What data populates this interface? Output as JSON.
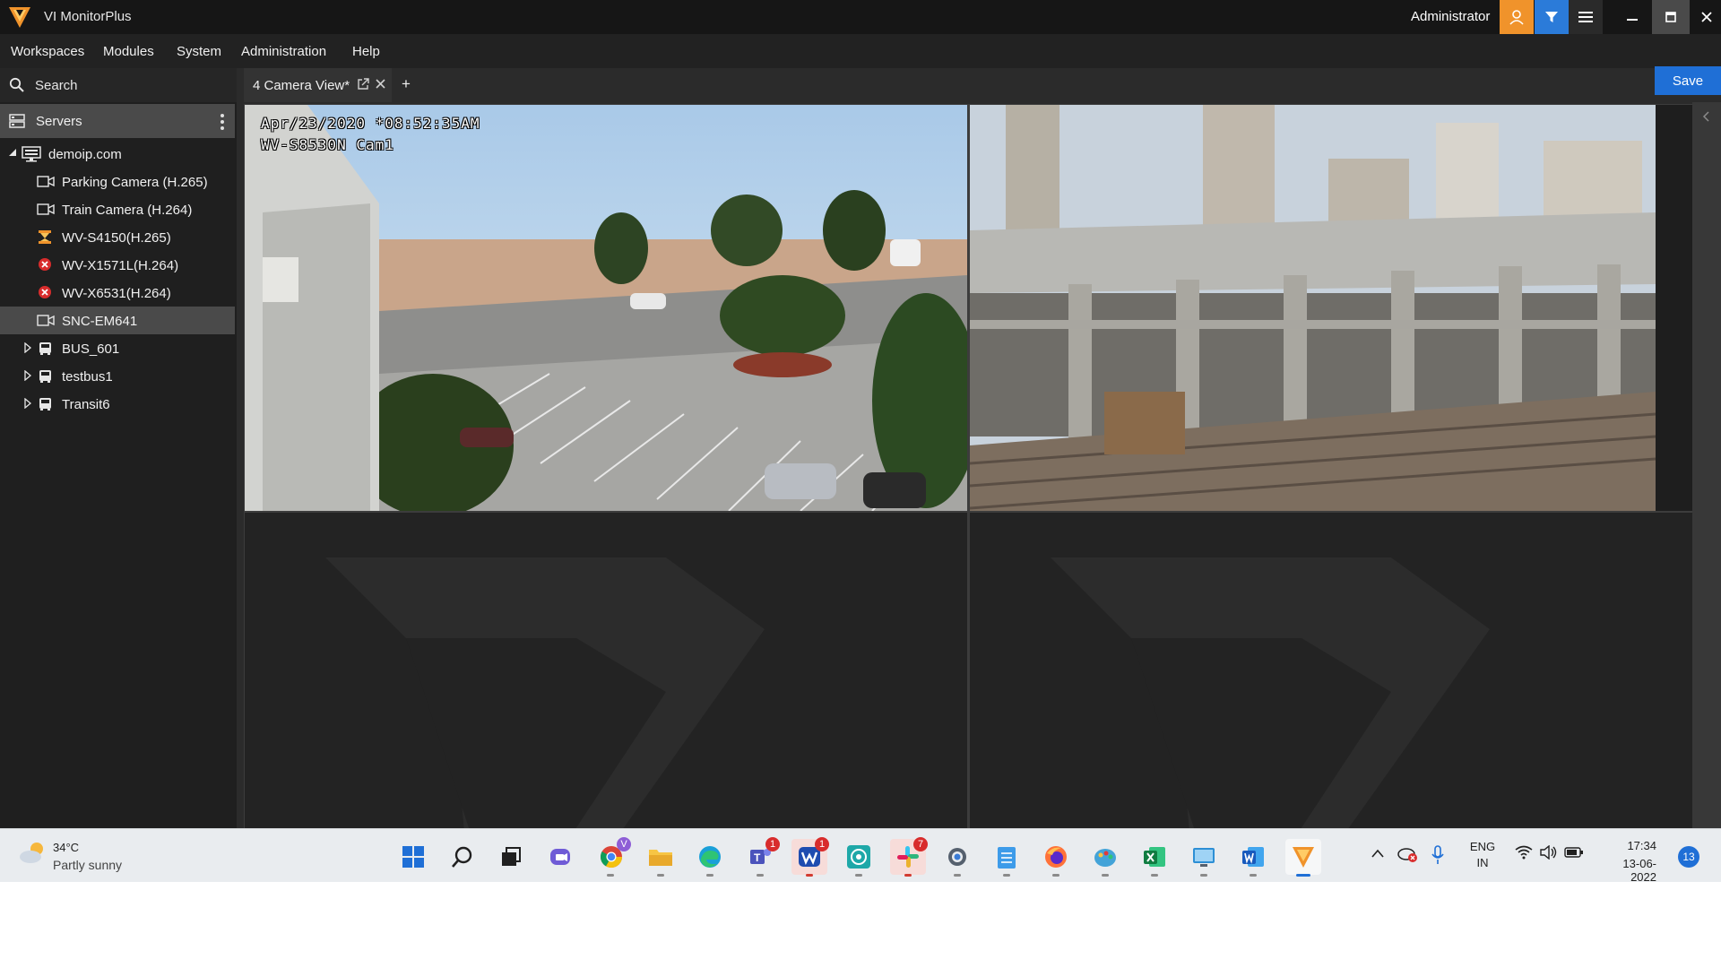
{
  "window": {
    "title": "VI MonitorPlus",
    "user": "Administrator"
  },
  "menu": [
    "Workspaces",
    "Modules",
    "System",
    "Administration",
    "Help"
  ],
  "sidebar": {
    "search_label": "Search",
    "servers_label": "Servers",
    "root": "demoip.com",
    "cameras": [
      {
        "label": "Parking Camera (H.265)",
        "status": "online"
      },
      {
        "label": "Train Camera (H.264)",
        "status": "online"
      },
      {
        "label": "WV-S4150(H.265)",
        "status": "warning"
      },
      {
        "label": "WV-X1571L(H.264)",
        "status": "error"
      },
      {
        "label": "WV-X6531(H.264)",
        "status": "error"
      },
      {
        "label": "SNC-EM641",
        "status": "online",
        "selected": true
      }
    ],
    "groups": [
      "BUS_601",
      "testbus1",
      "Transit6"
    ]
  },
  "tabs": {
    "active": "4 Camera View*",
    "add": "+"
  },
  "toolbar": {
    "save_label": "Save"
  },
  "feeds": {
    "cam1_date": "Apr/23/2020 *08:52:35AM",
    "cam1_name": "WV-S8530N Cam1"
  },
  "taskbar": {
    "weather_temp": "34°C",
    "weather_desc": "Partly sunny",
    "apps": [
      {
        "name": "start-icon"
      },
      {
        "name": "search-icon"
      },
      {
        "name": "task-view-icon"
      },
      {
        "name": "chat-icon"
      },
      {
        "name": "chrome-icon",
        "badge": "V"
      },
      {
        "name": "file-explorer-icon"
      },
      {
        "name": "edge-icon"
      },
      {
        "name": "teams-icon",
        "badge": "1"
      },
      {
        "name": "webex-icon",
        "badge": "1"
      },
      {
        "name": "chatgpt-icon"
      },
      {
        "name": "slack-icon",
        "badge": "7"
      },
      {
        "name": "settings-icon"
      },
      {
        "name": "notepad-icon"
      },
      {
        "name": "firefox-icon"
      },
      {
        "name": "paint-icon"
      },
      {
        "name": "excel-icon"
      },
      {
        "name": "remote-desktop-icon"
      },
      {
        "name": "word-icon"
      },
      {
        "name": "vi-monitorplus-icon"
      }
    ],
    "lang_1": "ENG",
    "lang_2": "IN",
    "time": "17:34",
    "date": "13-06-2022",
    "notifications": "13"
  },
  "colors": {
    "accent_orange": "#f0932b",
    "accent_blue": "#1f6fd6",
    "error_red": "#d82c2c"
  }
}
